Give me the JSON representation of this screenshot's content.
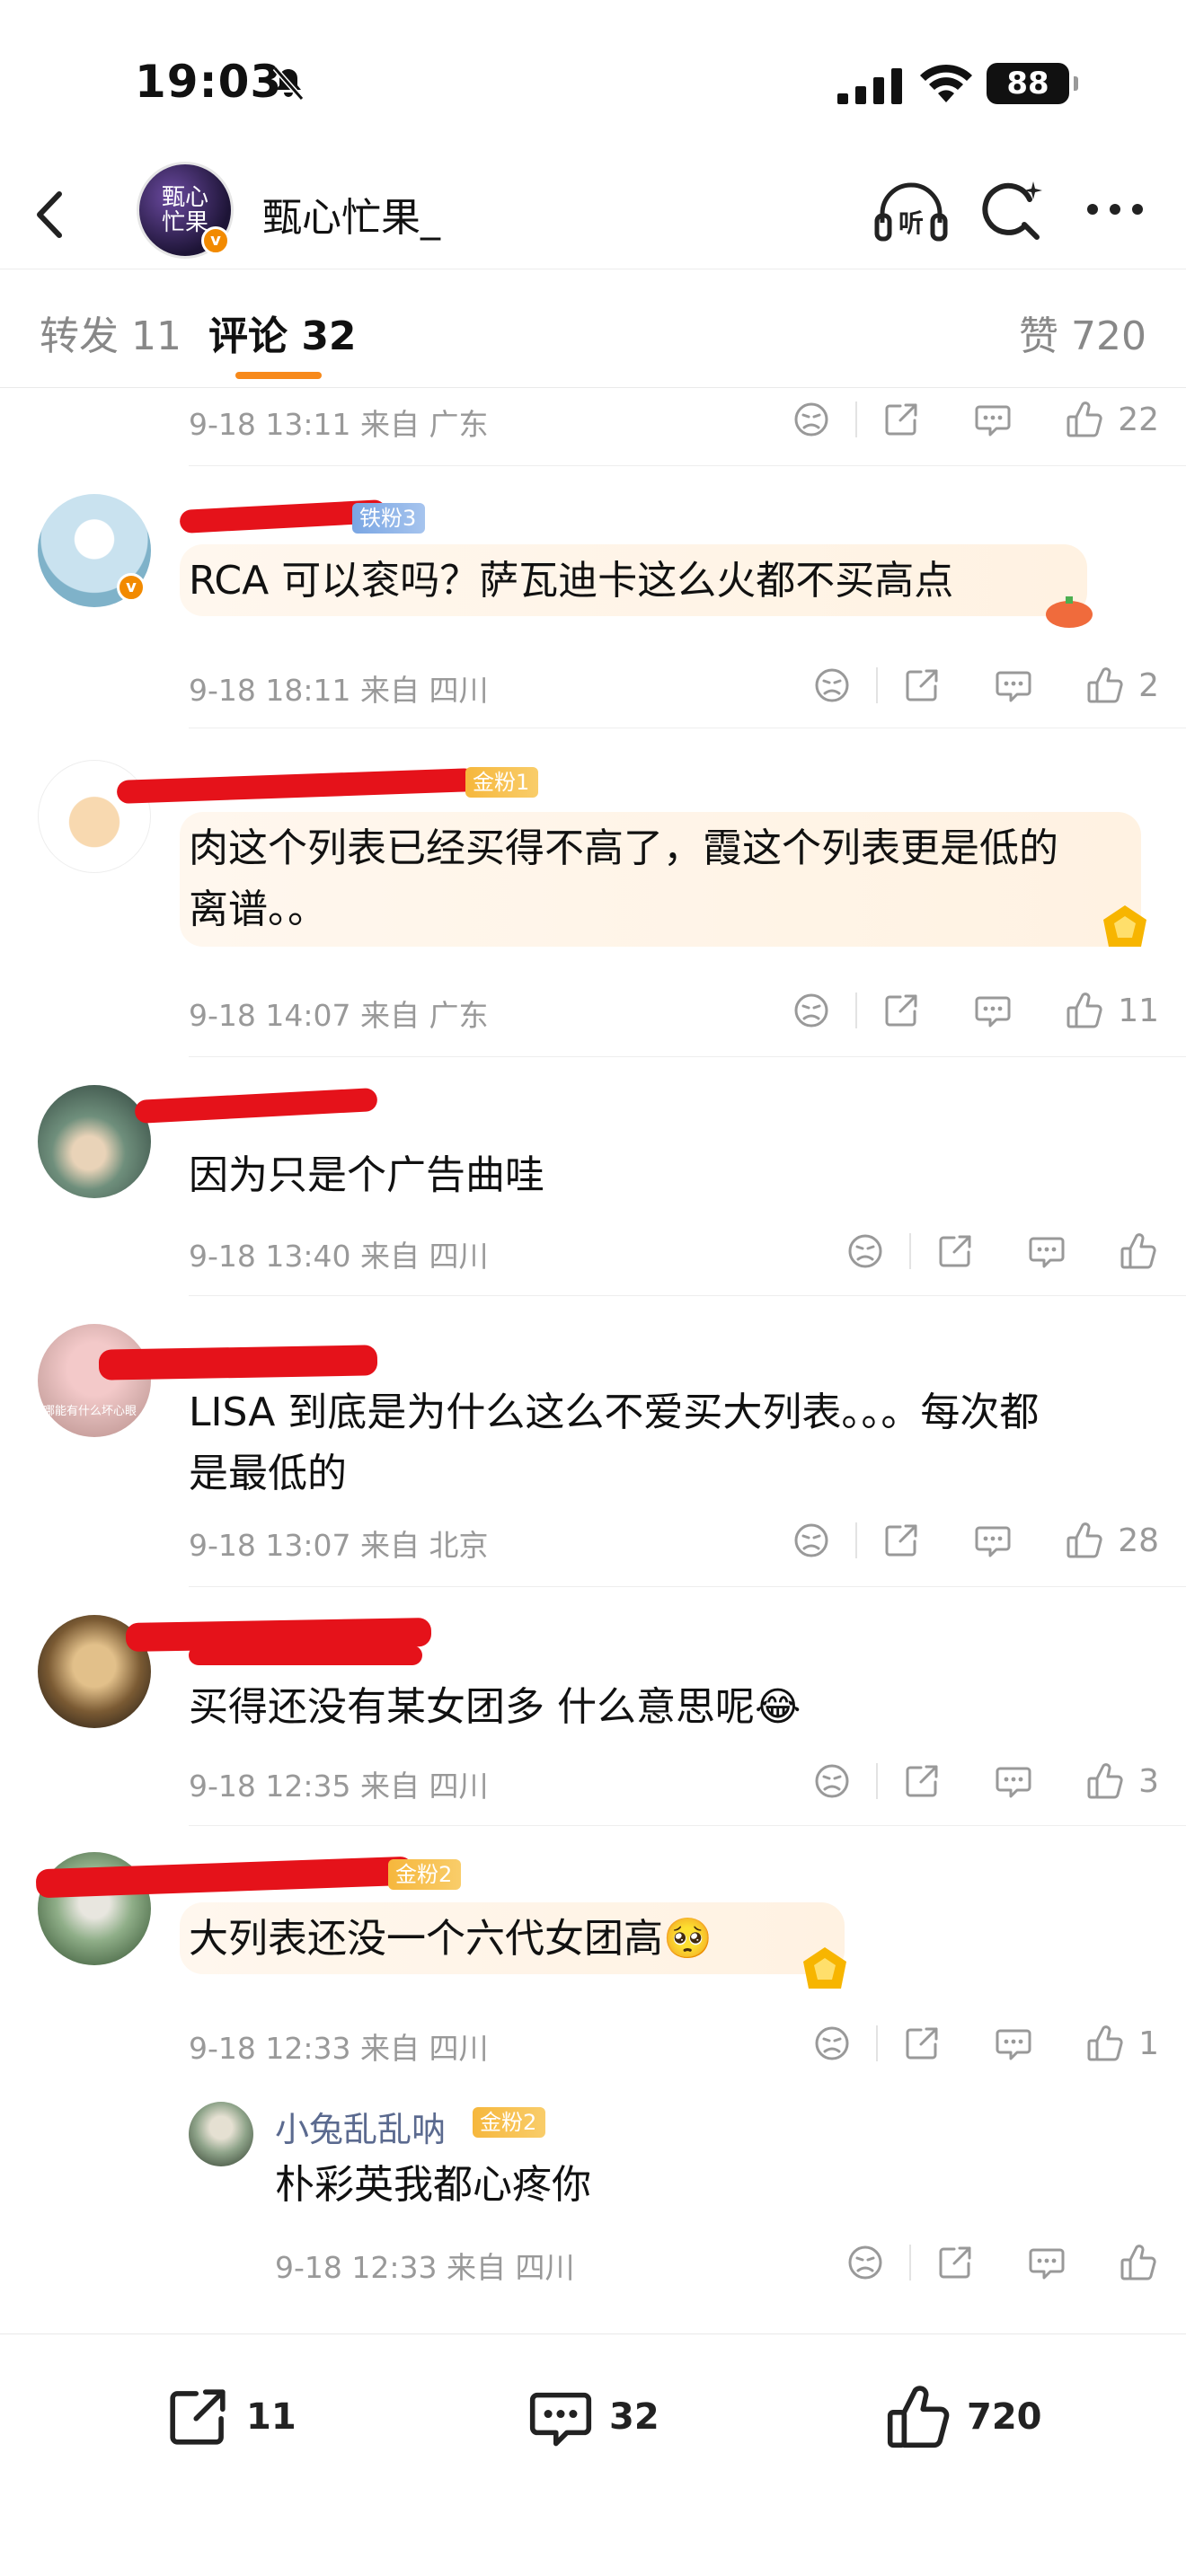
{
  "status": {
    "time": "19:03",
    "battery": "88"
  },
  "header": {
    "account_name": "甄心忙果_",
    "avatar_text": "甄心忙果"
  },
  "tabs": {
    "repost": "转发 11",
    "comments": "评论 32",
    "likes": "赞 720"
  },
  "comments": [
    {
      "meta": "9-18 13:11 来自 广东",
      "likes": "22"
    },
    {
      "badge": "铁粉3",
      "text": "RCA 可以衮吗？萨瓦迪卡这么火都不买高点",
      "meta": "9-18 18:11 来自 四川",
      "likes": "2"
    },
    {
      "badge": "金粉1",
      "text_line1": "肉这个列表已经买得不高了，霞这个列表更是低的",
      "text_line2": "离谱。。",
      "meta": "9-18 14:07 来自 广东",
      "likes": "11"
    },
    {
      "text": "因为只是个广告曲哇",
      "meta": "9-18 13:40 来自 四川",
      "likes": ""
    },
    {
      "avatar_caption": "哪能有什么坏心眼",
      "text_line1": "LISA 到底是为什么这么不爱买大列表。。。每次都",
      "text_line2": "是最低的",
      "meta": "9-18 13:07 来自 北京",
      "likes": "28"
    },
    {
      "text": "买得还没有某女团多 什么意思呢",
      "emoji": "😂",
      "meta": "9-18 12:35 来自 四川",
      "likes": "3"
    },
    {
      "badge": "金粉2",
      "text": "大列表还没一个六代女团高",
      "emoji": "🥺",
      "meta": "9-18 12:33 来自 四川",
      "likes": "1"
    }
  ],
  "reply": {
    "username": "小兔乱乱呐",
    "badge": "金粉2",
    "text": "朴彩英我都心疼你",
    "meta": "9-18 12:33 来自 四川"
  },
  "bottom_bar": {
    "reposts": "11",
    "comments": "32",
    "likes": "720"
  }
}
